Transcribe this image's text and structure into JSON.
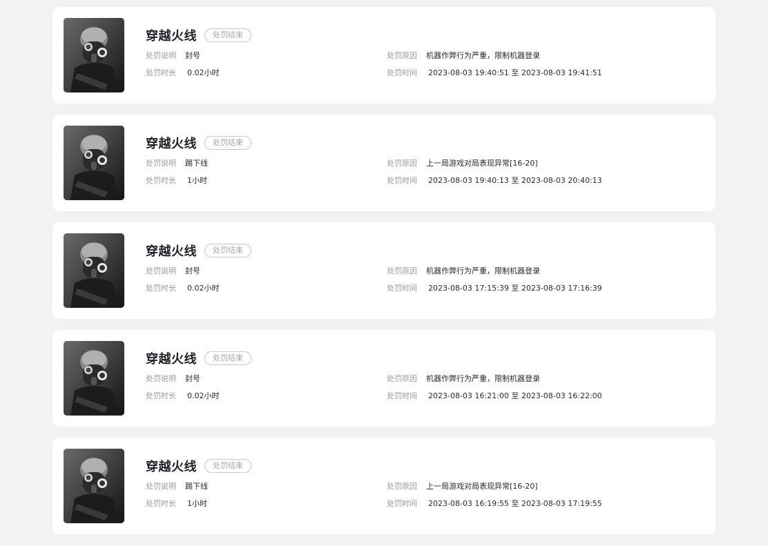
{
  "labels": {
    "desc": "处罚说明",
    "duration": "处罚时长",
    "reason": "处罚原因",
    "time": "处罚时间"
  },
  "records": [
    {
      "game": "穿越火线",
      "status": "处罚结束",
      "desc": "封号",
      "duration": "0.02小时",
      "reason": "机器作弊行为严重，限制机器登录",
      "time": "2023-08-03 19:40:51 至 2023-08-03 19:41:51"
    },
    {
      "game": "穿越火线",
      "status": "处罚结束",
      "desc": "踢下线",
      "duration": "1小时",
      "reason": "上一局游戏对局表现异常[16-20]",
      "time": "2023-08-03 19:40:13 至 2023-08-03 20:40:13"
    },
    {
      "game": "穿越火线",
      "status": "处罚结束",
      "desc": "封号",
      "duration": "0.02小时",
      "reason": "机器作弊行为严重，限制机器登录",
      "time": "2023-08-03 17:15:39 至 2023-08-03 17:16:39"
    },
    {
      "game": "穿越火线",
      "status": "处罚结束",
      "desc": "封号",
      "duration": "0.02小时",
      "reason": "机器作弊行为严重，限制机器登录",
      "time": "2023-08-03 16:21:00 至 2023-08-03 16:22:00"
    },
    {
      "game": "穿越火线",
      "status": "处罚结束",
      "desc": "踢下线",
      "duration": "1小时",
      "reason": "上一局游戏对局表现异常[16-20]",
      "time": "2023-08-03 16:19:55 至 2023-08-03 17:19:55"
    }
  ]
}
